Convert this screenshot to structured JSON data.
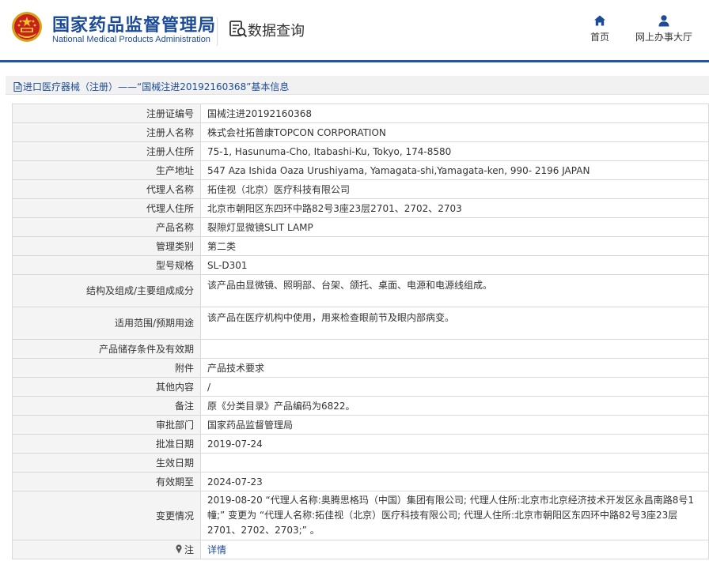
{
  "header": {
    "brand_cn": "国家药品监督管理局",
    "brand_en": "National Medical Products Administration",
    "query_title": "数据查询",
    "nav": [
      {
        "label": "首页",
        "icon": "home-icon"
      },
      {
        "label": "网上办事大厅",
        "icon": "user-icon"
      }
    ]
  },
  "breadcrumb": {
    "text": "进口医疗器械（注册）——“国械注进20192160368”基本信息"
  },
  "colors": {
    "brand_blue": "#1d4c97",
    "header_line": "#1f57a7",
    "label_bg": "#f4f4f4",
    "border": "#d9d9d9"
  },
  "fields": [
    {
      "label": "注册证编号",
      "value": "国械注进20192160368"
    },
    {
      "label": "注册人名称",
      "value": "株式会社拓普康TOPCON CORPORATION"
    },
    {
      "label": "注册人住所",
      "value": "75-1, Hasunuma-Cho, Itabashi-Ku, Tokyo, 174-8580"
    },
    {
      "label": "生产地址",
      "value": "547 Aza Ishida Oaza Urushiyama, Yamagata-shi,Yamagata-ken, 990- 2196 JAPAN"
    },
    {
      "label": "代理人名称",
      "value": "拓佳视（北京）医疗科技有限公司"
    },
    {
      "label": "代理人住所",
      "value": "北京市朝阳区东四环中路82号3座23层2701、2702、2703"
    },
    {
      "label": "产品名称",
      "value": "裂隙灯显微镜SLIT LAMP"
    },
    {
      "label": "管理类别",
      "value": "第二类"
    },
    {
      "label": "型号规格",
      "value": "SL-D301"
    },
    {
      "label": "结构及组成/主要组成成分",
      "value": "该产品由显微镜、照明部、台架、颌托、桌面、电源和电源线组成。"
    },
    {
      "label": "适用范围/预期用途",
      "value": "该产品在医疗机构中使用，用来检查眼前节及眼内部病变。"
    },
    {
      "label": "产品储存条件及有效期",
      "value": ""
    },
    {
      "label": "附件",
      "value": "产品技术要求"
    },
    {
      "label": "其他内容",
      "value": "/"
    },
    {
      "label": "备注",
      "value": "原《分类目录》产品编码为6822。"
    },
    {
      "label": "审批部门",
      "value": "国家药品监督管理局"
    },
    {
      "label": "批准日期",
      "value": "2019-07-24"
    },
    {
      "label": "生效日期",
      "value": ""
    },
    {
      "label": "有效期至",
      "value": "2024-07-23"
    },
    {
      "label": "变更情况",
      "value": "2019-08-20 “代理人名称:奥腾思格玛（中国）集团有限公司; 代理人住所:北京市北京经济技术开发区永昌南路8号1幢;” 变更为 “代理人名称:拓佳视（北京）医疗科技有限公司; 代理人住所:北京市朝阳区东四环中路82号3座23层2701、2702、2703;” 。"
    },
    {
      "label": "注",
      "value": "详情",
      "icon": "pin-icon"
    }
  ]
}
